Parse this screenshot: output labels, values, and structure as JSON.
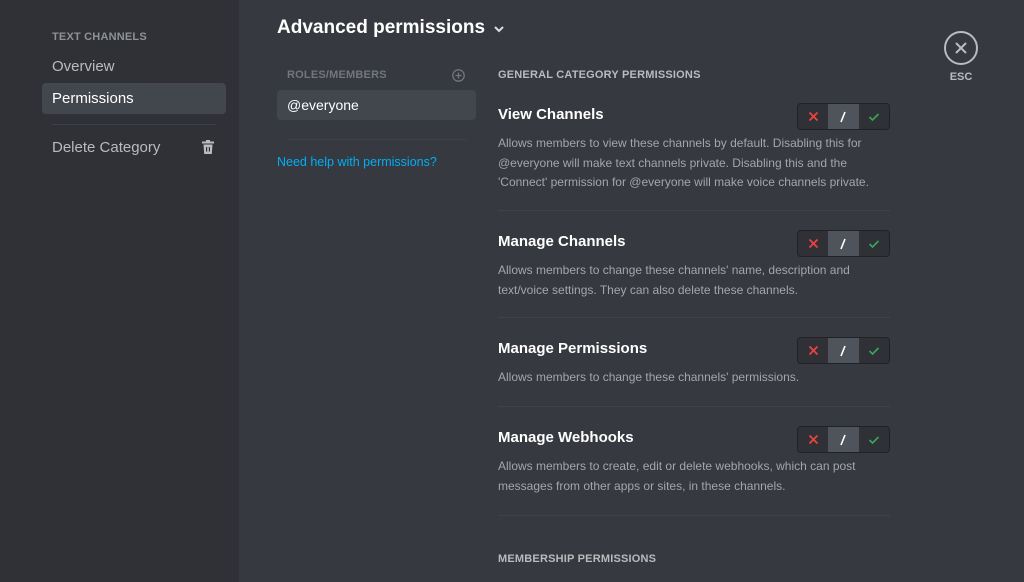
{
  "sidebar": {
    "header": "TEXT CHANNELS",
    "items": [
      {
        "label": "Overview",
        "active": false
      },
      {
        "label": "Permissions",
        "active": true
      }
    ],
    "delete_label": "Delete Category"
  },
  "header": {
    "title": "Advanced permissions"
  },
  "roles": {
    "header": "ROLES/MEMBERS",
    "items": [
      "@everyone"
    ],
    "help_link": "Need help with permissions?"
  },
  "sections": [
    {
      "header": "GENERAL CATEGORY PERMISSIONS",
      "permissions": [
        {
          "title": "View Channels",
          "description": "Allows members to view these channels by default. Disabling this for @everyone will make text channels private. Disabling this and the 'Connect' permission for @everyone will make voice channels private.",
          "state": "neutral"
        },
        {
          "title": "Manage Channels",
          "description": "Allows members to change these channels' name, description and text/voice settings. They can also delete these channels.",
          "state": "neutral"
        },
        {
          "title": "Manage Permissions",
          "description": "Allows members to change these channels' permissions.",
          "state": "neutral"
        },
        {
          "title": "Manage Webhooks",
          "description": "Allows members to create, edit or delete webhooks, which can post messages from other apps or sites, in these channels.",
          "state": "neutral"
        }
      ]
    },
    {
      "header": "MEMBERSHIP PERMISSIONS",
      "permissions": []
    }
  ],
  "close": {
    "label": "ESC"
  },
  "colors": {
    "deny": "#ed4245",
    "allow": "#3ba55d",
    "link": "#00aff4"
  }
}
